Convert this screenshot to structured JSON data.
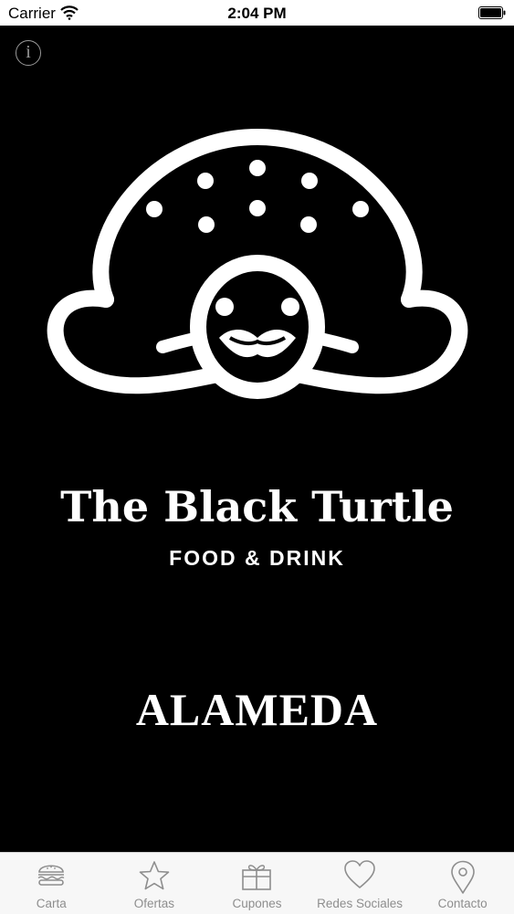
{
  "status_bar": {
    "carrier": "Carrier",
    "time": "2:04 PM"
  },
  "main": {
    "brand_name": "The Black Turtle",
    "brand_tagline": "FOOD & DRINK",
    "location": "ALAMEDA",
    "info_icon_glyph": "i"
  },
  "tab_bar": {
    "items": [
      {
        "label": "Carta",
        "icon": "burger-icon"
      },
      {
        "label": "Ofertas",
        "icon": "star-icon"
      },
      {
        "label": "Cupones",
        "icon": "gift-icon"
      },
      {
        "label": "Redes Sociales",
        "icon": "heart-icon"
      },
      {
        "label": "Contacto",
        "icon": "map-pin-icon"
      }
    ]
  },
  "colors": {
    "background": "#000000",
    "tab_inactive": "#8e8e8e",
    "tab_bar_bg": "#f7f7f7"
  }
}
